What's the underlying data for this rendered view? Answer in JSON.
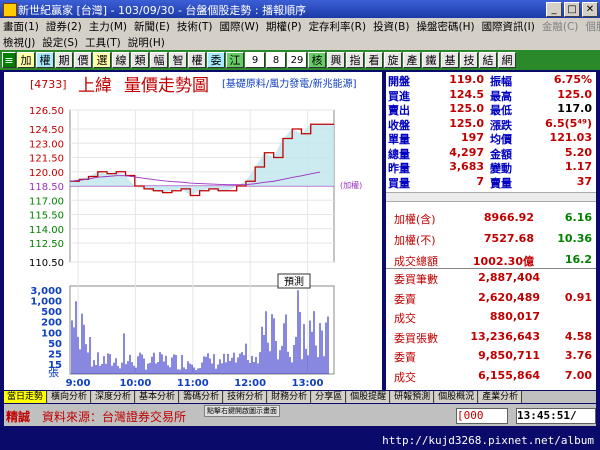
{
  "window": {
    "title": "新世紀贏家 [台灣] - 103/09/30 - 台盤個股走勢 : 播報順序"
  },
  "menu1": [
    "畫面(1)",
    "證券(2)",
    "主力(M)",
    "新聞(E)",
    "技術(T)",
    "國際(W)",
    "期權(P)",
    "定存利率(R)",
    "投資(B)",
    "操盤密碼(H)",
    "國際資訊(I)",
    "金融(C)",
    "個股(G)",
    "功能資訊(F)"
  ],
  "menu2": [
    "檢視(J)",
    "設定(S)",
    "工具(T)",
    "說明(H)"
  ],
  "toolbar": [
    "加",
    "權",
    "期",
    "價",
    "選",
    "線",
    "類",
    "幅",
    "智",
    "權",
    "委",
    "江",
    "9",
    "8",
    "29",
    "核",
    "興",
    "指",
    "看",
    "旋",
    "產",
    "鐵",
    "基",
    "技",
    "結",
    "網"
  ],
  "chart": {
    "code": "[4733]",
    "name": "上緯",
    "title": "量價走勢圖",
    "tags": "[基礎原料/風力發電/新兆能源]",
    "ref_label": "(加權)",
    "vol_button": "預測",
    "vol_unit": "張",
    "price_ticks": [
      "126.50",
      "124.50",
      "123.00",
      "121.50",
      "120.00",
      "118.50",
      "117.00",
      "115.50",
      "114.00",
      "112.50",
      "110.50"
    ],
    "vol_ticks": [
      "3,000",
      "1,000",
      "500",
      "200",
      "100",
      "50",
      "25",
      "15"
    ],
    "time_ticks": [
      "9:00",
      "10:00",
      "11:00",
      "12:00",
      "13:00"
    ]
  },
  "chart_data": {
    "type": "line",
    "x": [
      "9:00",
      "9:10",
      "9:20",
      "9:30",
      "9:40",
      "9:50",
      "10:00",
      "10:10",
      "10:20",
      "10:30",
      "10:40",
      "10:50",
      "11:00",
      "11:10",
      "11:20",
      "11:30",
      "11:40",
      "11:50",
      "12:00",
      "12:10",
      "12:20",
      "12:30",
      "12:40",
      "12:50",
      "13:00",
      "13:10",
      "13:20",
      "13:30"
    ],
    "series": [
      {
        "values": [
          119.0,
          119.2,
          119.5,
          120.0,
          119.8,
          120.0,
          119.6,
          118.5,
          118.2,
          118.0,
          117.8,
          118.0,
          118.2,
          117.5,
          118.0,
          118.2,
          118.0,
          118.0,
          118.5,
          119.0,
          120.5,
          122.0,
          121.5,
          123.5,
          124.5,
          124.0,
          125.0,
          125.0
        ]
      }
    ],
    "ylim": [
      110.5,
      126.5
    ],
    "ref_price": 118.5,
    "colors": {
      "price": "#c00000",
      "fill": "#bfe6ee",
      "ref": "#9a30c0"
    }
  },
  "quote": {
    "rows": [
      {
        "l1": "開盤",
        "v1": "119.0",
        "l2": "振幅",
        "v2": "6.75%"
      },
      {
        "l1": "買進",
        "v1": "124.5",
        "l2": "最高",
        "v2": "125.0"
      },
      {
        "l1": "賣出",
        "v1": "125.0",
        "l2": "最低",
        "v2": "117.0"
      },
      {
        "l1": "收盤",
        "v1": "125.0",
        "l2": "漲跌",
        "v2": "6.5(5⁴⁹)"
      },
      {
        "l1": "單量",
        "v1": "197",
        "l2": "均價",
        "v2": "121.03"
      },
      {
        "l1": "總量",
        "v1": "4,297",
        "l2": "金額",
        "v2": "5.20"
      },
      {
        "l1": "昨量",
        "v1": "3,683",
        "l2": "變動",
        "v2": "1.17"
      },
      {
        "l1": "買量",
        "v1": "7",
        "l2": "賣量",
        "v2": "37"
      }
    ]
  },
  "index": {
    "rows": [
      {
        "l": "加權(含)",
        "v": "8966.92",
        "c": "6.16"
      },
      {
        "l": "加權(不)",
        "v": "7527.68",
        "c": "10.36"
      },
      {
        "l": "成交總額",
        "v": "1002.30億",
        "c": "16.2"
      }
    ]
  },
  "orders": {
    "rows": [
      {
        "l": "委買筆數",
        "v": "2,887,404",
        "c": ""
      },
      {
        "l": "委賣",
        "v": "2,620,489",
        "c": "0.91"
      },
      {
        "l": "成交",
        "v": "880,017",
        "c": ""
      },
      {
        "l": "委買張數",
        "v": "13,236,643",
        "c": "4.58"
      },
      {
        "l": "委賣",
        "v": "9,850,711",
        "c": "3.76"
      },
      {
        "l": "成交",
        "v": "6,155,864",
        "c": "7.00"
      }
    ]
  },
  "tabs": [
    "當日走勢",
    "橫向分析",
    "深度分析",
    "基本分析",
    "籌碼分析",
    "技術分析",
    "財務分析",
    "分享區",
    "個股提醒",
    "研報預測",
    "個股概況",
    "產業分析"
  ],
  "status": {
    "left1": "精誠",
    "left2": "資料來源：台灣證券交易所",
    "hint": "點擊右鍵開啟圖示畫面",
    "code": "[000",
    "time": "13:45:51/"
  },
  "footer": {
    "url": "http://kujd3268.pixnet.net/album"
  }
}
